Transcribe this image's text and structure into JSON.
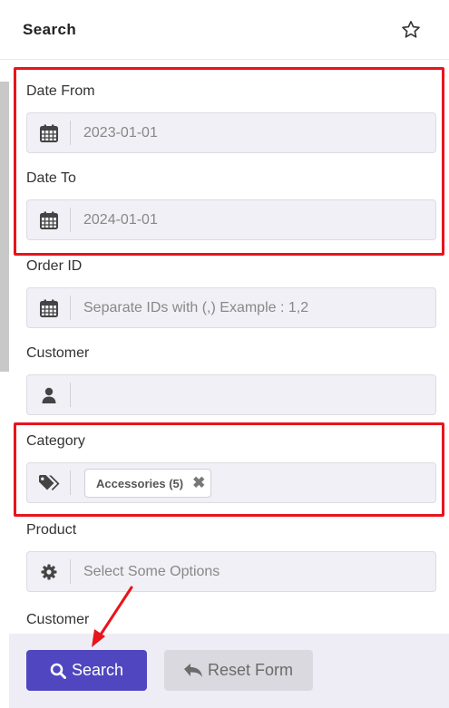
{
  "header": {
    "title": "Search"
  },
  "form": {
    "date_from": {
      "label": "Date From",
      "placeholder": "2023-01-01"
    },
    "date_to": {
      "label": "Date To",
      "placeholder": "2024-01-01"
    },
    "order_id": {
      "label": "Order ID",
      "placeholder": "Separate IDs with (,) Example : 1,2"
    },
    "customer": {
      "label": "Customer",
      "placeholder": ""
    },
    "category": {
      "label": "Category",
      "tags": [
        "Accessories (5)"
      ],
      "remove_glyph": "✖"
    },
    "product": {
      "label": "Product",
      "placeholder": "Select Some Options"
    },
    "customer2": {
      "label": "Customer"
    }
  },
  "buttons": {
    "search": "Search",
    "reset": "Reset Form"
  },
  "icons": {
    "star": "star-icon",
    "calendar": "calendar-icon",
    "user": "user-icon",
    "tags": "tags-icon",
    "gear": "gear-icon",
    "search": "search-icon",
    "undo": "undo-icon"
  },
  "colors": {
    "primary": "#5046c0",
    "highlight": "#e8141c",
    "field_bg": "#f1f0f6",
    "reset_bg": "#d9d9df"
  }
}
